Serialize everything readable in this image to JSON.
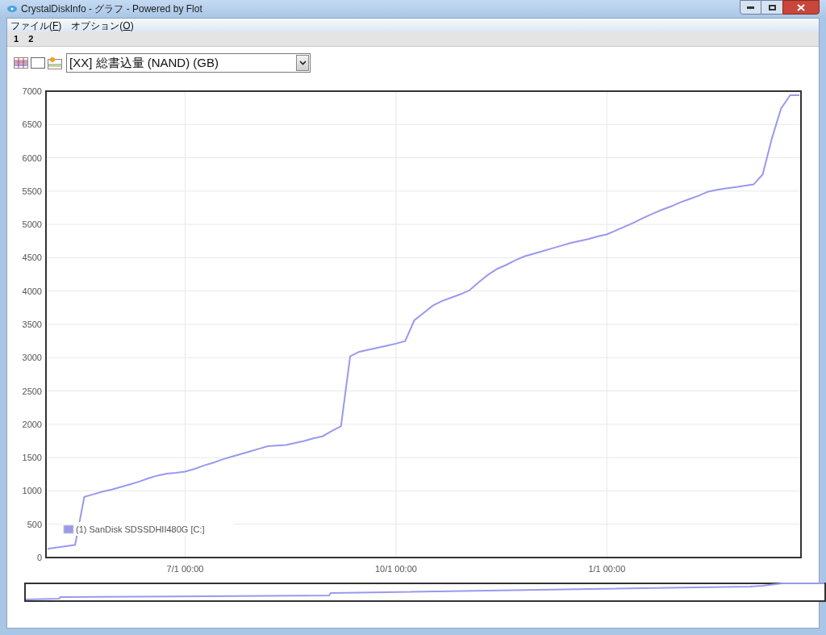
{
  "window": {
    "title": "CrystalDiskInfo - グラフ - Powered by Flot"
  },
  "menu": [
    {
      "label": "ファイル(",
      "key": "F",
      "suffix": ")"
    },
    {
      "label": "オプション(",
      "key": "O",
      "suffix": ")"
    }
  ],
  "tabs": [
    {
      "label": "1"
    },
    {
      "label": "2"
    }
  ],
  "attribute_select": {
    "value": "[XX] 総書込量 (NAND) (GB)"
  },
  "chart": {
    "chart_data": {
      "type": "line",
      "grid": true,
      "ylim": [
        0,
        7000
      ],
      "yticks": [
        0,
        500,
        1000,
        1500,
        2000,
        2500,
        3000,
        3500,
        4000,
        4500,
        5000,
        5500,
        6000,
        6500,
        7000
      ],
      "categories": [
        null,
        null,
        null,
        null,
        null,
        null,
        null,
        null,
        null,
        null,
        null,
        null,
        null,
        null,
        null,
        "7/1 00:00",
        null,
        null,
        null,
        null,
        null,
        null,
        null,
        null,
        null,
        null,
        null,
        null,
        null,
        null,
        null,
        null,
        null,
        null,
        null,
        null,
        null,
        null,
        "10/1 00:00",
        null,
        null,
        null,
        null,
        null,
        null,
        null,
        null,
        null,
        null,
        null,
        null,
        null,
        null,
        null,
        null,
        null,
        null,
        null,
        null,
        null,
        null,
        "1/1 00:00",
        null,
        null,
        null,
        null,
        null,
        null,
        null,
        null,
        null,
        null,
        null,
        null,
        null,
        null,
        null,
        null,
        null,
        null,
        null,
        null,
        null
      ],
      "series": [
        {
          "name": "(1) SanDisk SDSSDHII480G [C:]",
          "color": "#9999ee",
          "values": [
            130,
            150,
            170,
            190,
            910,
            950,
            990,
            1020,
            1060,
            1100,
            1140,
            1190,
            1230,
            1260,
            1270,
            1290,
            1330,
            1380,
            1420,
            1470,
            1510,
            1550,
            1590,
            1630,
            1670,
            1680,
            1690,
            1720,
            1750,
            1790,
            1820,
            1900,
            1970,
            3020,
            3090,
            3120,
            3150,
            3180,
            3210,
            3250,
            3560,
            3670,
            3780,
            3850,
            3900,
            3950,
            4010,
            4130,
            4240,
            4330,
            4390,
            4460,
            4520,
            4560,
            4600,
            4640,
            4680,
            4720,
            4750,
            4780,
            4820,
            4850,
            4910,
            4970,
            5030,
            5100,
            5160,
            5220,
            5270,
            5330,
            5380,
            5430,
            5490,
            5520,
            5540,
            5560,
            5580,
            5600,
            5750,
            6290,
            6740,
            6940,
            6940
          ]
        }
      ]
    }
  }
}
